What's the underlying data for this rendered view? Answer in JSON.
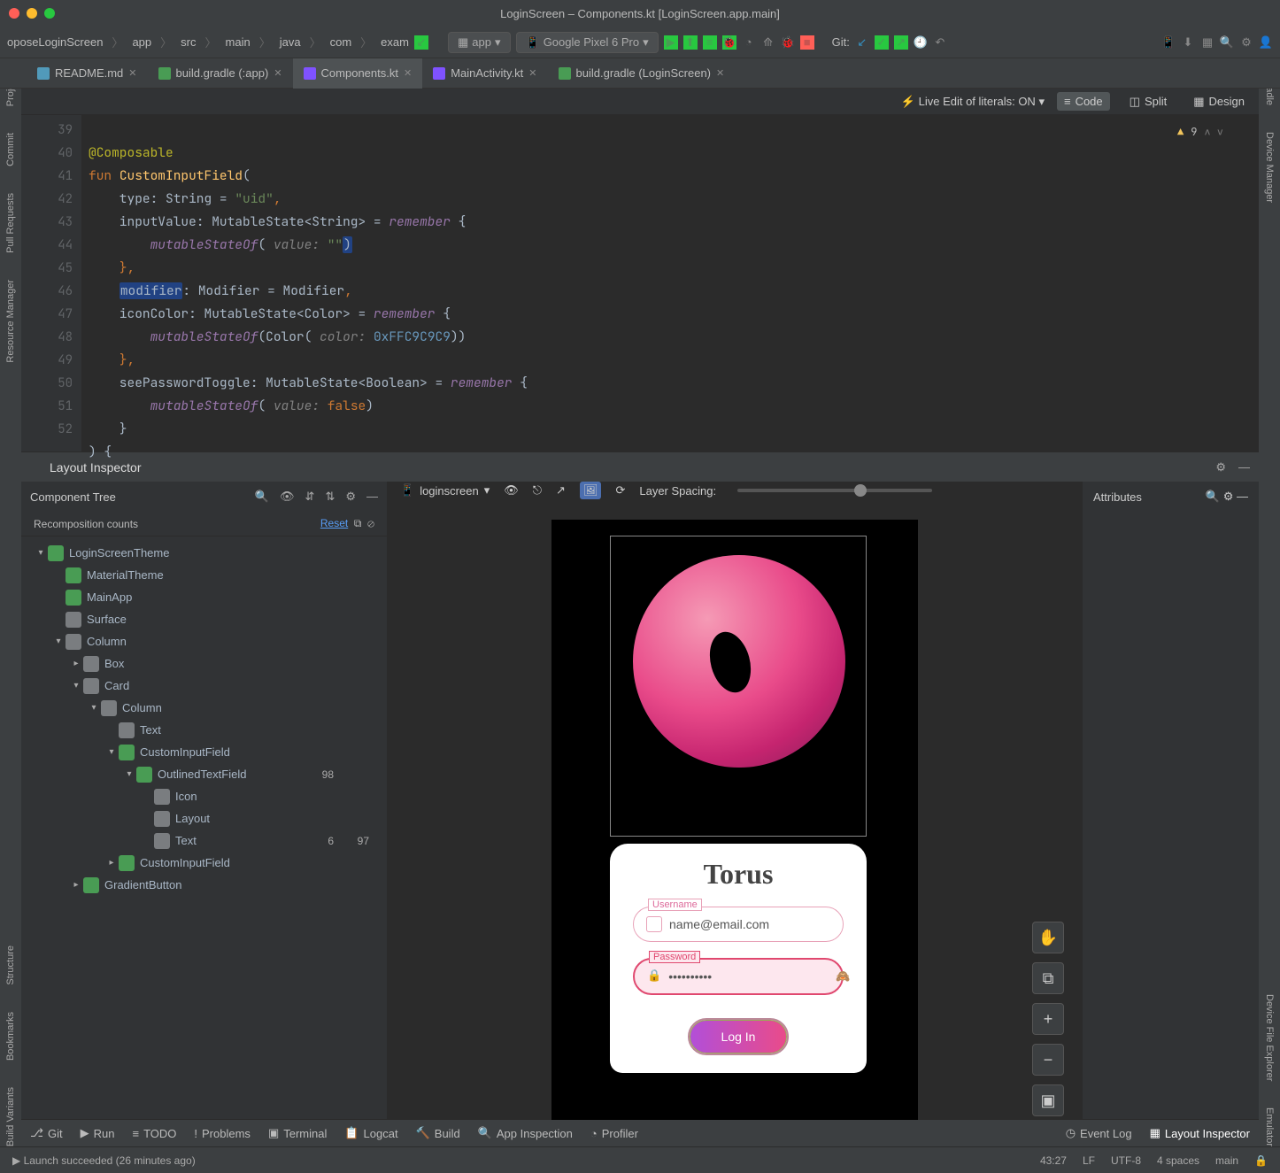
{
  "window_title": "LoginScreen – Components.kt [LoginScreen.app.main]",
  "breadcrumbs": [
    "oposeLoginScreen",
    "app",
    "src",
    "main",
    "java",
    "com",
    "exam"
  ],
  "run_config": "app",
  "device_target": "Google Pixel 6 Pro",
  "git_label": "Git:",
  "left_stripe": [
    "Project",
    "Commit",
    "Pull Requests",
    "Resource Manager",
    "Structure",
    "Bookmarks",
    "Build Variants"
  ],
  "right_stripe": [
    "Gradle",
    "Device Manager",
    "Device File Explorer",
    "Emulator"
  ],
  "editor_tabs": [
    {
      "name": "README.md",
      "icon": "md"
    },
    {
      "name": "build.gradle (:app)",
      "icon": "gr"
    },
    {
      "name": "Components.kt",
      "icon": "kt",
      "active": true
    },
    {
      "name": "MainActivity.kt",
      "icon": "kt"
    },
    {
      "name": "build.gradle (LoginScreen)",
      "icon": "gr"
    }
  ],
  "live_edit": "Live Edit of literals: ON",
  "view_modes": {
    "code": "Code",
    "split": "Split",
    "design": "Design"
  },
  "warnings_count": "9",
  "code_lines": [
    39,
    40,
    41,
    42,
    43,
    44,
    45,
    46,
    47,
    48,
    49,
    50,
    51,
    52
  ],
  "code": {
    "l39": "@Composable",
    "l40a": "fun ",
    "l40b": "CustomInputField",
    "l40c": "(",
    "l41": "    type: String = ",
    "l41s": "\"uid\"",
    "l41e": ",",
    "l42": "    inputValue: MutableState<String> = ",
    "l42r": "remember",
    "l42e": " {",
    "l43a": "        ",
    "l43b": "mutableStateOf",
    "l43c": "(",
    "l43h": " value: ",
    "l43s": "\"\"",
    "l43d": ")",
    "l44": "    },",
    "l45a": "    ",
    "l45m": "modifier",
    "l45b": ": Modifier = Modifier",
    "l45c": ",",
    "l46": "    iconColor: MutableState<Color> = ",
    "l46r": "remember",
    "l46e": " {",
    "l47a": "        ",
    "l47b": "mutableStateOf",
    "l47c": "(Color(",
    "l47h": " color: ",
    "l47n": "0xFFC9C9C9",
    "l47d": "))",
    "l48": "    },",
    "l49": "    seePasswordToggle: MutableState<Boolean> = ",
    "l49r": "remember",
    "l49e": " {",
    "l50a": "        ",
    "l50b": "mutableStateOf",
    "l50c": "(",
    "l50h": " value: ",
    "l50k": "false",
    "l50d": ")",
    "l51": "    }",
    "l52": ") {"
  },
  "layout_inspector": {
    "title": "Layout Inspector",
    "component_tree": "Component Tree",
    "recomposition": "Recomposition counts",
    "reset": "Reset",
    "device": "loginscreen",
    "layer_spacing": "Layer Spacing:",
    "attributes": "Attributes",
    "tree": [
      {
        "d": 0,
        "label": "LoginScreenTheme",
        "icon": "g",
        "exp": true
      },
      {
        "d": 1,
        "label": "MaterialTheme",
        "icon": "g"
      },
      {
        "d": 1,
        "label": "MainApp",
        "icon": "g"
      },
      {
        "d": 1,
        "label": "Surface",
        "icon": "gy"
      },
      {
        "d": 1,
        "label": "Column",
        "icon": "gy",
        "exp": true
      },
      {
        "d": 2,
        "label": "Box",
        "icon": "gy",
        "col": true
      },
      {
        "d": 2,
        "label": "Card",
        "icon": "gy",
        "exp": true
      },
      {
        "d": 3,
        "label": "Column",
        "icon": "gy",
        "exp": true
      },
      {
        "d": 4,
        "label": "Text",
        "icon": "ab"
      },
      {
        "d": 4,
        "label": "CustomInputField",
        "icon": "g",
        "exp": true
      },
      {
        "d": 5,
        "label": "OutlinedTextField",
        "icon": "g",
        "exp": true,
        "c1": "98"
      },
      {
        "d": 6,
        "label": "Icon",
        "icon": "gy"
      },
      {
        "d": 6,
        "label": "Layout",
        "icon": "gy"
      },
      {
        "d": 6,
        "label": "Text",
        "icon": "ab",
        "c1": "6",
        "c2": "97"
      },
      {
        "d": 4,
        "label": "CustomInputField",
        "icon": "g",
        "col": true
      },
      {
        "d": 2,
        "label": "GradientButton",
        "icon": "g",
        "col": true
      }
    ]
  },
  "preview": {
    "card_title": "Torus",
    "username_label": "Username",
    "username_value": "name@email.com",
    "password_label": "Password",
    "password_value": "••••••••••",
    "login": "Log In"
  },
  "bottom_tools": [
    "Git",
    "Run",
    "TODO",
    "Problems",
    "Terminal",
    "Logcat",
    "Build",
    "App Inspection",
    "Profiler"
  ],
  "bottom_right": [
    "Event Log",
    "Layout Inspector"
  ],
  "status_msg": "Launch succeeded (26 minutes ago)",
  "status_right": [
    "43:27",
    "LF",
    "UTF-8",
    "4 spaces",
    "main"
  ]
}
